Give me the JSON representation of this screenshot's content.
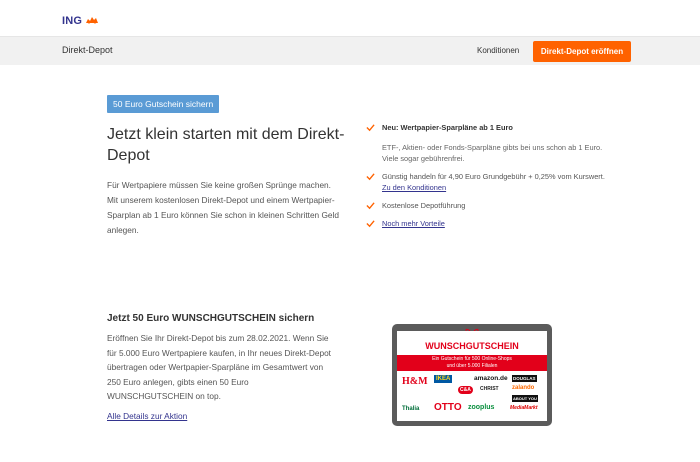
{
  "header": {
    "logo_text": "ING",
    "subnav_title": "Direkt-Depot",
    "conditions_link": "Konditionen",
    "cta_label": "Direkt-Depot eröffnen"
  },
  "hero": {
    "badge": "50 Euro Gutschein sichern",
    "headline": "Jetzt klein starten mit dem Direkt-Depot",
    "intro": "Für Wertpapiere müssen Sie keine großen Sprünge machen. Mit unserem kostenlosen Direkt-Depot und einem Wertpapier-Sparplan ab 1 Euro können Sie schon in kleinen Schritten Geld anlegen."
  },
  "benefits": [
    {
      "title": "Neu: Wertpapier-Sparpläne ab 1 Euro",
      "text": "ETF-, Aktien- oder Fonds-Sparpläne gibts bei uns schon ab 1 Euro. Viele sogar gebührenfrei."
    },
    {
      "text": "Günstig handeln für 4,90 Euro Grundgebühr + 0,25% vom Kurswert.",
      "link": "Zu den Konditionen"
    },
    {
      "text": "Kostenlose Depotführung"
    },
    {
      "link": "Noch mehr Vorteile"
    }
  ],
  "promo": {
    "title": "Jetzt 50 Euro WUNSCHGUTSCHEIN sichern",
    "text": "Eröffnen Sie Ihr Direkt-Depot bis zum 28.02.2021. Wenn Sie für 5.000 Euro Wertpapiere kaufen, in Ihr neues Direkt-Depot übertragen oder Wertpapier-Sparpläne im Gesamtwert von 250 Euro anlegen, gibts einen 50 Euro WUNSCHGUTSCHEIN on top.",
    "details_link": "Alle Details zur Aktion"
  },
  "voucher": {
    "heading": "WUNSCHGUTSCHEIN",
    "band_line1": "Ein Gutschein für 500 Online-Shops",
    "band_line2": "und über 5.000 Filialen",
    "logos": [
      "H&M",
      "IKEA",
      "amazon.de",
      "DOUGLAS",
      "CHRIST",
      "C&A",
      "zalando",
      "Thalia",
      "OTTO",
      "zooplus",
      "MediaMarkt",
      "ABOUT YOU"
    ],
    "colors": {
      "red": "#e2001a",
      "frame": "#5b5b5b"
    }
  },
  "colors": {
    "ing_orange": "#ff6200",
    "ing_blue": "#33348e",
    "badge_blue": "#5a9bd5",
    "check_orange": "#ff6200"
  }
}
